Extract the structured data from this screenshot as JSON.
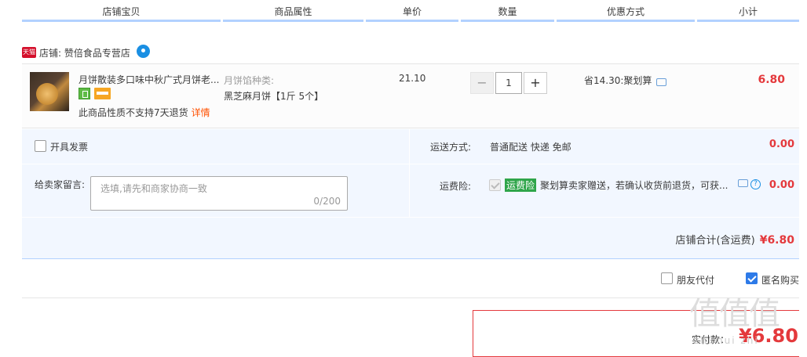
{
  "header": {
    "columns": [
      "店铺宝贝",
      "商品属性",
      "单价",
      "数量",
      "优惠方式",
      "小计"
    ]
  },
  "shop": {
    "badge": "天猫",
    "label": "店铺: 赞倍食品专营店"
  },
  "item": {
    "title": "月饼散装多口味中秋广式月饼老...",
    "attr_label": "月饼馅种类:",
    "attr_value": "黑芝麻月饼【1斤 5个】",
    "note": "此商品性质不支持7天退货",
    "detail_link": "详情",
    "unit_price": "21.10",
    "quantity": "1",
    "qty_minus": "−",
    "qty_plus": "+",
    "discount": "省14.30:聚划算",
    "subtotal": "6.80"
  },
  "options": {
    "invoice_label": "开具发票",
    "shipping_label": "运送方式:",
    "shipping_value": "普通配送 快递 免邮",
    "shipping_amount": "0.00",
    "message_label": "给卖家留言:",
    "message_placeholder": "选填,请先和商家协商一致",
    "message_count": "0/200",
    "insurance_label": "运费险:",
    "insurance_tag": "运费险",
    "insurance_text": "聚划算卖家赠送，若确认收货前退货，可获...",
    "insurance_amount": "0.00",
    "total_label": "店铺合计(含运费)",
    "total_value": "¥6.80"
  },
  "footer": {
    "friend_pay_label": "朋友代付",
    "anonymous_label": "匿名购买",
    "pay_label": "实付款：",
    "pay_amount": "¥6.80",
    "watermark": "值值值",
    "watermark_sub": "zhi hui zhi"
  },
  "colors": {
    "accent_red": "#e4393c",
    "header_line": "#b2d1ff",
    "option_bg": "#f2f7ff",
    "checkbox_blue": "#2d7ae8",
    "insurance_green": "#2fa54a"
  }
}
